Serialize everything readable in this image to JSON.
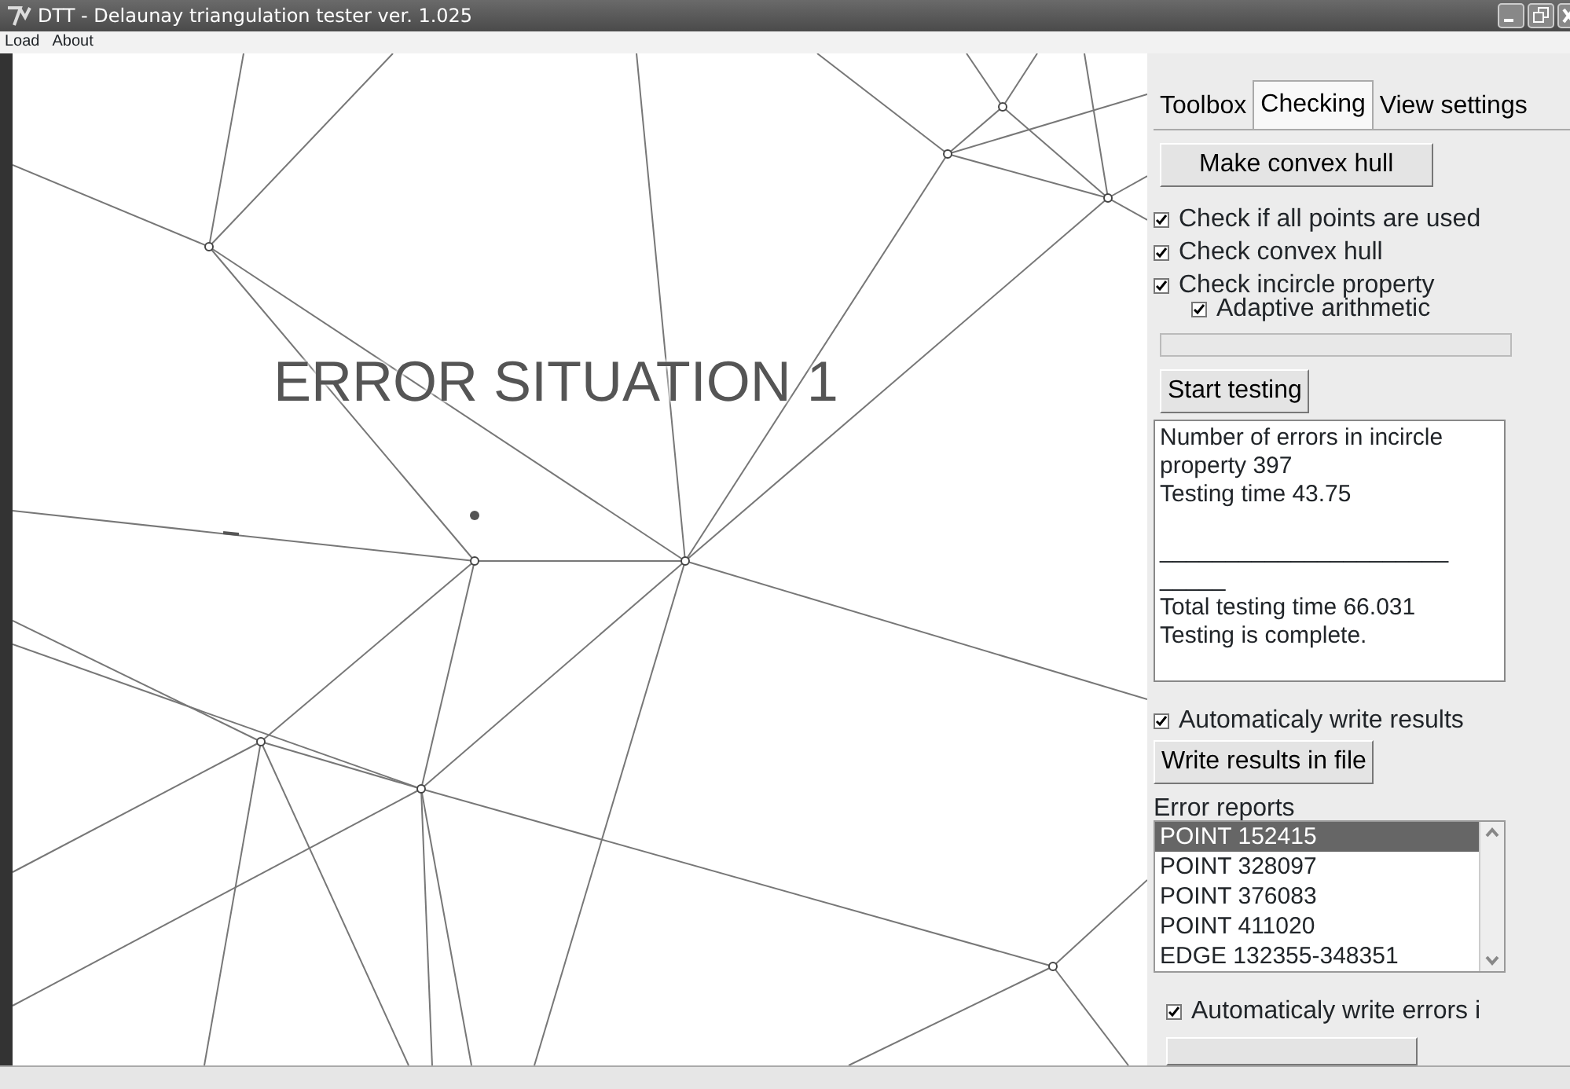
{
  "window": {
    "title": "DTT - Delaunay triangulation tester ver. 1.025"
  },
  "menu": [
    "Load",
    "About"
  ],
  "canvas": {
    "overlay_text": "ERROR SITUATION 1"
  },
  "tabs": [
    {
      "label": "Toolbox",
      "selected": false
    },
    {
      "label": "Checking",
      "selected": true
    },
    {
      "label": "View settings",
      "selected": false
    }
  ],
  "checking": {
    "convex_hull_button": "Make convex hull",
    "options": [
      {
        "label": "Check if all points are used",
        "checked": true,
        "indented": false
      },
      {
        "label": "Check convex hull",
        "checked": true,
        "indented": false
      },
      {
        "label": "Check incircle property",
        "checked": true,
        "indented": false
      },
      {
        "label": "Adaptive arithmetic",
        "checked": true,
        "indented": true
      }
    ],
    "progress": {
      "level": 0
    },
    "start_button": "Start testing",
    "results": "Number of errors in incircle property 397\nTesting time 43.75\n\n______________________\n_____\nTotal testing time 66.031\nTesting is complete.",
    "auto_write_results": {
      "label": "Automaticaly write results",
      "checked": true
    },
    "write_results_button": "Write results in file",
    "error_reports_label": "Error reports",
    "error_reports": [
      {
        "text": "POINT 152415",
        "selected": true
      },
      {
        "text": "POINT 328097",
        "selected": false
      },
      {
        "text": "POINT 376083",
        "selected": false
      },
      {
        "text": "POINT 411020",
        "selected": false
      },
      {
        "text": "EDGE 132355-348351",
        "selected": false
      }
    ],
    "auto_write_errors": {
      "label": "Automaticaly write errors i",
      "checked": true
    }
  }
}
